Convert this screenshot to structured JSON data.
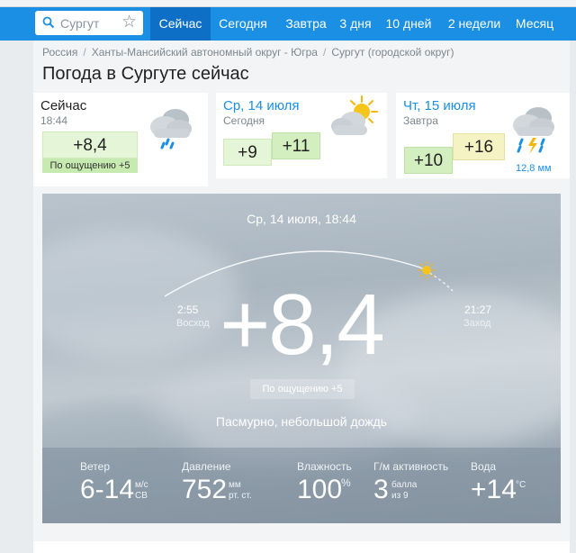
{
  "search": {
    "placeholder": "Сургут"
  },
  "nav": {
    "items": [
      "Сейчас",
      "Сегодня",
      "Завтра",
      "3 дня",
      "10 дней",
      "2 недели",
      "Месяц"
    ]
  },
  "breadcrumb": [
    "Россия",
    "Ханты-Мансийский автономный округ - Югра",
    "Сургут (городской округ)"
  ],
  "page_title": "Погода в Сургуте сейчас",
  "now_card": {
    "title": "Сейчас",
    "time": "18:44",
    "temp": "+8,4",
    "feels": "По ощущению +5",
    "icon": "cloud-rain-icon"
  },
  "today_card": {
    "title": "Ср, 14 июля",
    "subtitle": "Сегодня",
    "temp_min": "+9",
    "temp_max": "+11",
    "icon": "sun-cloud-icon"
  },
  "tomorrow_card": {
    "title": "Чт, 15 июля",
    "subtitle": "Завтра",
    "temp_min": "+10",
    "temp_max": "+16",
    "precip": "12,8 мм",
    "icon": "thunderstorm-icon"
  },
  "main": {
    "date": "Ср, 14 июля, 18:44",
    "sunrise_time": "2:55",
    "sunrise_label": "Восход",
    "sunset_time": "21:27",
    "sunset_label": "Заход",
    "temp": "+8,4",
    "feels": "По ощущению +5",
    "condition": "Пасмурно, небольшой дождь"
  },
  "stats": {
    "wind": {
      "label": "Ветер",
      "value": "6-14",
      "unit": "м/с",
      "dir": "СВ"
    },
    "pressure": {
      "label": "Давление",
      "value": "752",
      "unit": "мм",
      "unit2": "рт. ст."
    },
    "humidity": {
      "label": "Влажность",
      "value": "100",
      "unit": "%"
    },
    "geomag": {
      "label": "Г/м активность",
      "value": "3",
      "unit": "балла",
      "unit2": "из 9"
    },
    "water": {
      "label": "Вода",
      "value": "+14",
      "unit": "°C"
    }
  },
  "colors": {
    "nav_bg": "#1a8fe3",
    "nav_active": "#0d6fc6",
    "accent": "#1a8fe3"
  }
}
